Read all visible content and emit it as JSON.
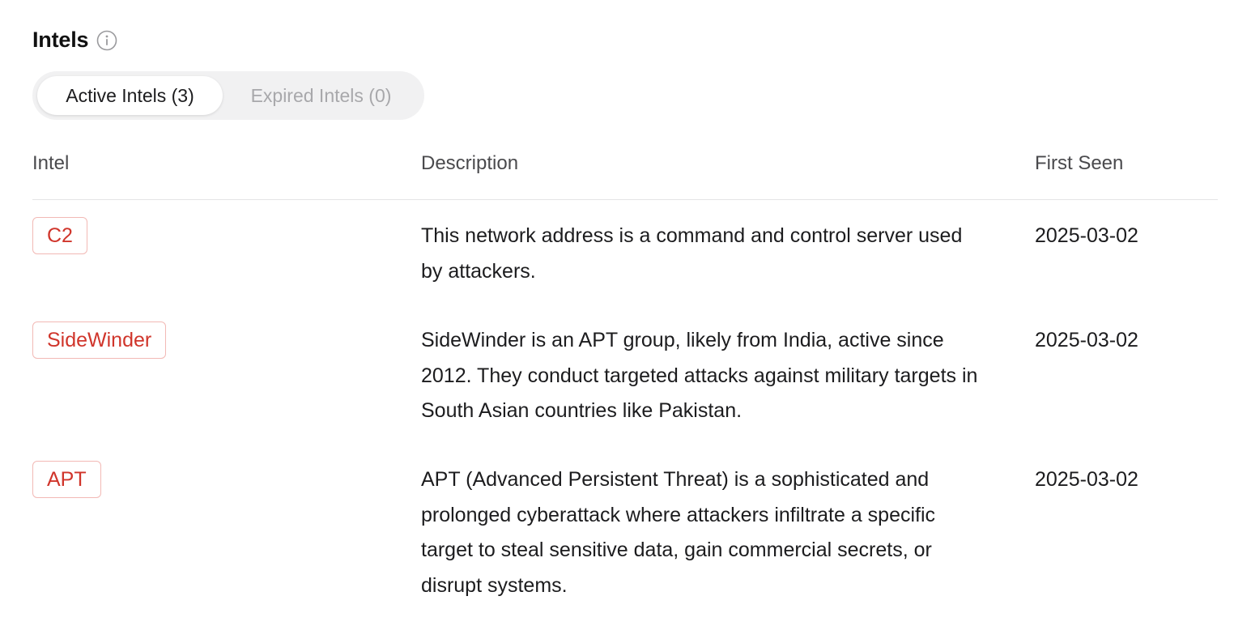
{
  "header": {
    "title": "Intels",
    "info_icon": "info-circle-icon"
  },
  "tabs": [
    {
      "label": "Active Intels (3)",
      "active": true
    },
    {
      "label": "Expired Intels (0)",
      "active": false
    }
  ],
  "table": {
    "columns": [
      "Intel",
      "Description",
      "First Seen"
    ],
    "rows": [
      {
        "intel": "C2",
        "description": "This network address is a command and control server used by attackers.",
        "first_seen": "2025-03-02"
      },
      {
        "intel": "SideWinder",
        "description": "SideWinder is an APT group, likely from India, active since 2012. They conduct targeted attacks against military targets in South Asian countries like Pakistan.",
        "first_seen": "2025-03-02"
      },
      {
        "intel": "APT",
        "description": "APT (Advanced Persistent Threat) is a sophisticated and prolonged cyberattack where attackers infiltrate a specific target to steal sensitive data, gain commercial secrets, or disrupt systems.",
        "first_seen": "2025-03-02"
      }
    ]
  },
  "colors": {
    "tag_text": "#d0352b",
    "tag_border": "#f2b9b5",
    "tab_track": "#f1f1f2",
    "inactive_tab_text": "#a8a8ab"
  }
}
